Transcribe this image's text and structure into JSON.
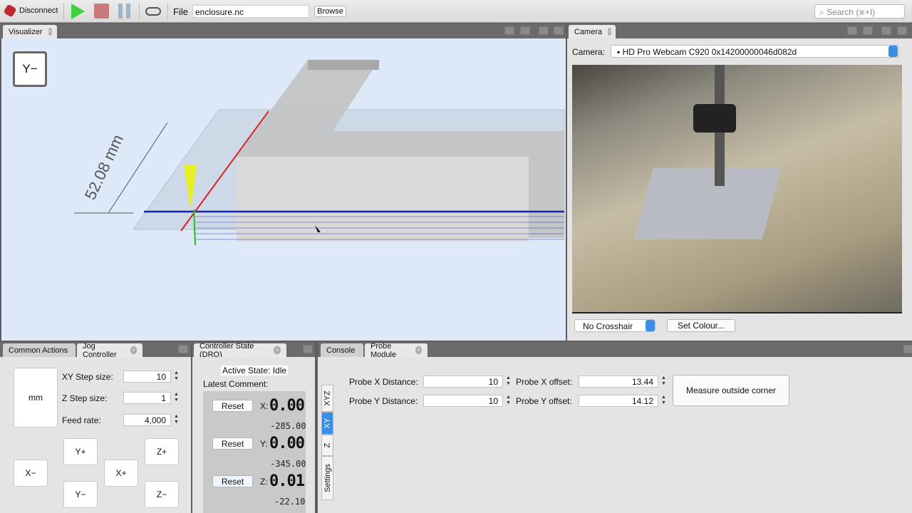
{
  "toolbar": {
    "disconnect": "Disconnect",
    "file_label": "File",
    "file_value": "enclosure.nc",
    "browse": "Browse",
    "search_placeholder": "Search (⌘+I)"
  },
  "visualizer": {
    "tab": "Visualizer",
    "view_cube": "Y−",
    "dimension": "52.08 mm"
  },
  "camera": {
    "tab": "Camera",
    "label": "Camera:",
    "device": "HD Pro Webcam C920 0x14200000046d082d",
    "crosshair": "No Crosshair",
    "set_colour": "Set Colour..."
  },
  "jog": {
    "tabs": [
      "Common Actions",
      "Jog Controller"
    ],
    "units": "mm",
    "xy_step_label": "XY Step size:",
    "xy_step": "10",
    "z_step_label": "Z Step size:",
    "z_step": "1",
    "feed_label": "Feed rate:",
    "feed": "4,000",
    "buttons": {
      "xm": "X−",
      "xp": "X+",
      "yp": "Y+",
      "ym": "Y−",
      "zp": "Z+",
      "zm": "Z−"
    }
  },
  "dro": {
    "tab": "Controller State (DRO)",
    "active_state_label": "Active State:",
    "active_state": "Idle",
    "latest_comment": "Latest Comment:",
    "reset": "Reset",
    "axes": [
      {
        "axis": "X:",
        "work": "0.00",
        "machine": "-285.00"
      },
      {
        "axis": "Y:",
        "work": "0.00",
        "machine": "-345.00"
      },
      {
        "axis": "Z:",
        "work": "0.01",
        "machine": "-22.10"
      }
    ]
  },
  "probe": {
    "tabs": [
      "Console",
      "Probe Module"
    ],
    "side_tabs": [
      "XYZ",
      "XY",
      "Z",
      "Settings"
    ],
    "active_side_tab": "XY",
    "x_dist_label": "Probe X Distance:",
    "x_dist": "10",
    "y_dist_label": "Probe Y Distance:",
    "y_dist": "10",
    "x_off_label": "Probe X offset:",
    "x_off": "13.44",
    "y_off_label": "Probe Y offset:",
    "y_off": "14.12",
    "measure": "Measure outside corner"
  },
  "colors": {
    "accent": "#3a8ee6",
    "play": "#3fcf3f",
    "stop": "#c87a7a",
    "pause": "#9fb4c4"
  }
}
